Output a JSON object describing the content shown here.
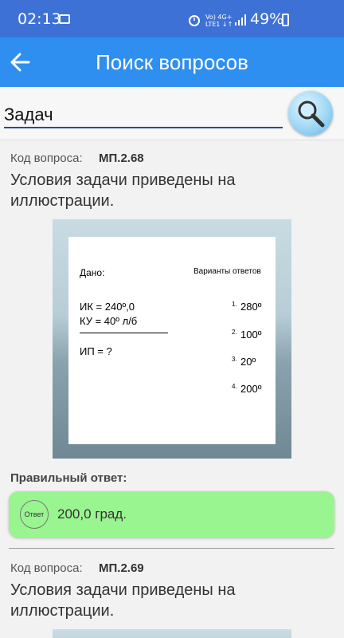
{
  "status_bar": {
    "time": "02:13",
    "network_top": "Vo) 4G+",
    "network_bottom": "LTE1 ↓↑",
    "battery": "49%"
  },
  "appbar": {
    "title": "Поиск вопросов",
    "back_icon": "arrow-left-icon"
  },
  "search": {
    "value": "Задач",
    "button_icon": "magnifier-icon"
  },
  "questions": [
    {
      "code_label": "Код вопроса:",
      "code": "МП.2.68",
      "text": "Условия задачи приведены на иллюстрации.",
      "illustration": {
        "given_label": "Дано:",
        "variants_label": "Варианты ответов",
        "line1": "ИК = 240º,0",
        "line2": "КУ = 40º л/б",
        "line3": "ИП = ?",
        "options": [
          {
            "num": "1.",
            "value": "280º"
          },
          {
            "num": "2.",
            "value": "100º"
          },
          {
            "num": "3.",
            "value": "20º"
          },
          {
            "num": "4.",
            "value": "200º"
          }
        ]
      },
      "answer_label": "Правильный ответ:",
      "answer_badge": "Ответ",
      "answer": "200,0 град."
    },
    {
      "code_label": "Код вопроса:",
      "code": "МП.2.69",
      "text": "Условия задачи приведены на иллюстрации."
    }
  ],
  "colors": {
    "status_bar": "#3d71d6",
    "app_bar": "#2f8ff0",
    "answer_bg": "#99f58f"
  }
}
